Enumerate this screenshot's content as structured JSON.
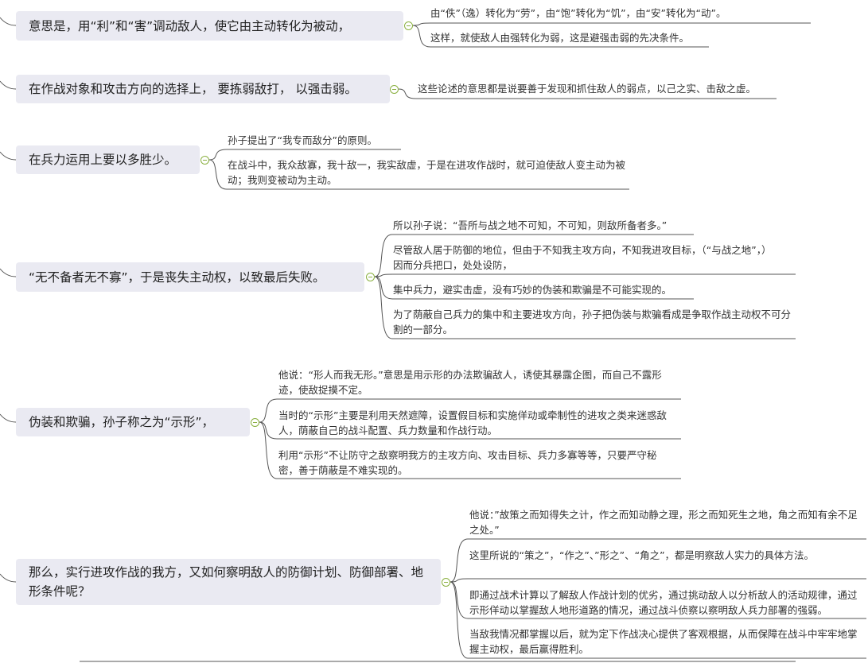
{
  "topics": [
    {
      "label": "意思是，用“利”和“害”调动敌人，使它由主动转化为被动，",
      "children": [
        "由“佚”（逸）转化为“劳”，由“饱”转化为“饥”，由“安”转化为“动”。",
        "这样，就使敌人由强转化为弱，这是避强击弱的先决条件。"
      ]
    },
    {
      "label": "在作战对象和攻击方向的选择上， 要拣弱敌打， 以强击弱。",
      "children": [
        "这些论述的意思都是说要善于发现和抓住敌人的弱点，以己之实、击敌之虚。"
      ]
    },
    {
      "label": "在兵力运用上要以多胜少。",
      "children": [
        "孙子提出了“我专而敌分”的原则。",
        "在战斗中，我众敌寡，我十敌一，我实敌虚，于是在进攻作战时，就可迫使敌人变主动为被动；我则变被动为主动。"
      ]
    },
    {
      "label": "“无不备者无不寡”，于是丧失主动权，以致最后失败。",
      "children": [
        "所以孙子说：“吾所与战之地不可知，不可知，则敌所备者多。”",
        "尽管敌人居于防御的地位，但由于不知我主攻方向，不知我进攻目标，（“与战之地”，）因而分兵把口，处处设防，",
        "集中兵力，避实击虚，没有巧妙的伪装和欺骗是不可能实现的。",
        "为了荫蔽自己兵力的集中和主要进攻方向，孙子把伪装与欺骗看成是争取作战主动权不可分割的一部分。"
      ]
    },
    {
      "label": "伪装和欺骗，孙子称之为“示形”，",
      "children": [
        "他说：“形人而我无形。”意思是用示形的办法欺骗敌人，诱使其暴露企图，而自己不露形迹，使敌捉摸不定。",
        "当时的“示形”主要是利用天然遮障，设置假目标和实施佯动或牵制性的进攻之类来迷惑敌人，荫蔽自己的战斗配置、兵力数量和作战行动。",
        "利用“示形”不让防守之敌察明我方的主攻方向、攻击目标、兵力多寡等等，只要严守秘密，善于荫蔽是不难实现的。"
      ]
    },
    {
      "label": "那么，实行进攻作战的我方，又如何察明敌人的防御计划、防御部署、地形条件呢？",
      "children": [
        "他说：”故策之而知得失之计，作之而知动静之理，形之而知死生之地，角之而知有余不足之处。”",
        "这里所说的“策之”，“作之”、”形之”、“角之”，都是明察敌人实力的具体方法。",
        "即通过战术计算以了解敌人作战计划的优劣，通过挑动敌人以分析敌人的活动规律，通过示形佯动以掌握敌人地形道路的情况，通过战斗侦察以察明敌人兵力部署的强弱。",
        "当敌我情况都掌握以后，就为定下作战决心提供了客观根据，从而保障在战斗中牢牢地掌握主动权，最后赢得胜利。"
      ]
    }
  ],
  "colors": {
    "node_bg": "#eaeaf2",
    "line": "#555555",
    "toggle": "#8ab040"
  },
  "icons": {
    "collapse": "collapse-toggle-icon"
  }
}
